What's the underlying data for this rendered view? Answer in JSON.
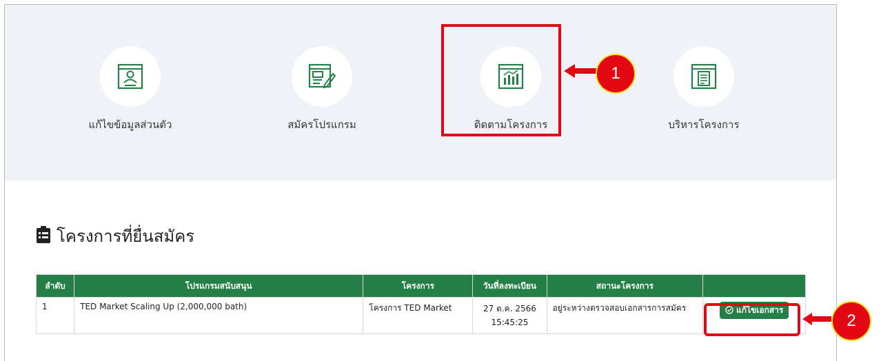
{
  "menu": {
    "items": [
      {
        "label": "แก้ไขข้อมูลส่วนตัว",
        "icon": "profile-card-icon"
      },
      {
        "label": "สมัครโปรแกรม",
        "icon": "form-edit-icon"
      },
      {
        "label": "ติดตามโครงการ",
        "icon": "chart-window-icon"
      },
      {
        "label": "บริหารโครงการ",
        "icon": "document-window-icon"
      }
    ]
  },
  "markers": {
    "one": "1",
    "two": "2"
  },
  "section": {
    "title": "โครงการที่ยื่นสมัคร",
    "icon": "clipboard-list-icon"
  },
  "table": {
    "headers": [
      "ลำดับ",
      "โปรแกรมสนับสนุน",
      "โครงการ",
      "วันที่ลงทะเบียน",
      "สถานะโครงการ",
      ""
    ],
    "rows": [
      {
        "no": "1",
        "program": "TED Market Scaling Up (2,000,000 bath)",
        "project": "โครงการ TED Market",
        "date": "27 ต.ค. 2566",
        "time": "15:45:25",
        "status": "อยู่ระหว่างตรวจสอบเอกสารการสมัคร",
        "action": "แก้ไขเอกสาร",
        "action_icon": "check-circle-icon"
      }
    ]
  },
  "colors": {
    "accent": "#237f45",
    "highlight": "#e30613",
    "marker_border": "#f7e11a",
    "band": "#eff2f6"
  }
}
